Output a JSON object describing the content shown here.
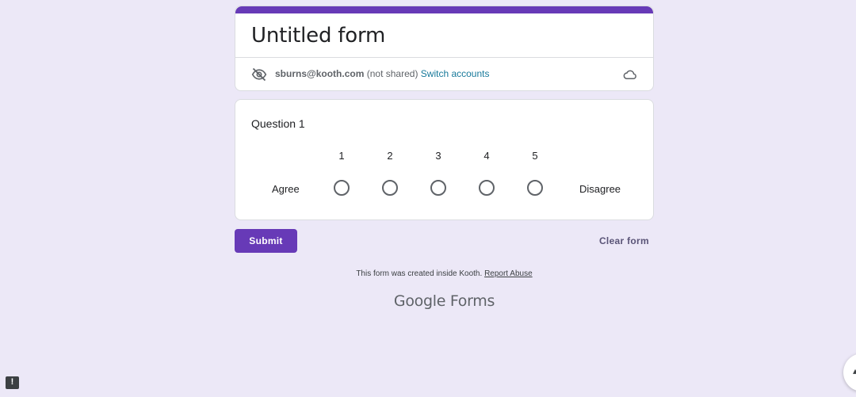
{
  "form": {
    "title": "Untitled form",
    "accent_color": "#673ab7"
  },
  "account": {
    "email": "sburns@kooth.com",
    "note": "(not shared)",
    "switch_label": "Switch accounts"
  },
  "question": {
    "title": "Question 1",
    "low_label": "Agree",
    "high_label": "Disagree",
    "scale": [
      "1",
      "2",
      "3",
      "4",
      "5"
    ]
  },
  "actions": {
    "submit_label": "Submit",
    "clear_label": "Clear form"
  },
  "footer": {
    "note": "This form was created inside Kooth.",
    "report_label": "Report Abuse",
    "brand_google": "Google",
    "brand_forms": "Forms"
  },
  "icons": {
    "privacy": "eye-off-icon",
    "cloud": "cloud-icon",
    "feedback": "feedback-icon"
  }
}
